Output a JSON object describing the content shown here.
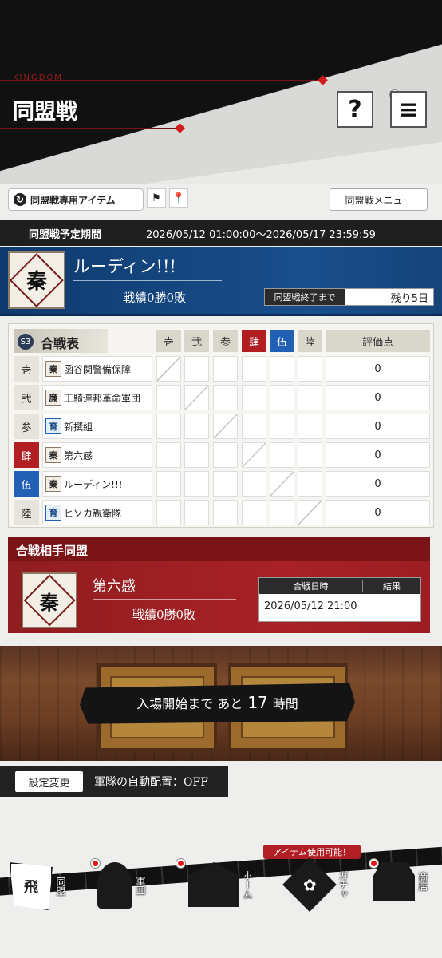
{
  "header": {
    "kingdom_label": "KINGDOM",
    "title": "同盟戦",
    "help_label": "?",
    "menu_label": "≡"
  },
  "toolbar": {
    "items_label": "同盟戦専用アイテム",
    "menu_label": "同盟戦メニュー"
  },
  "period": {
    "label": "同盟戦予定期間",
    "range": "2026/05/12 01:00:00～2026/05/17 23:59:59"
  },
  "my_alliance": {
    "emblem_char": "秦",
    "name": "ルーディン!!!",
    "record": "戦績0勝0敗",
    "end_label": "同盟戦終了まで",
    "remaining": "残り5日"
  },
  "battle_table": {
    "badge": "S3",
    "title": "合戦表",
    "columns": [
      "壱",
      "弐",
      "参",
      "肆",
      "伍",
      "陸"
    ],
    "points_header": "評価点",
    "rows": [
      {
        "label": "壱",
        "emblem": "秦",
        "name": "函谷関警備保障",
        "points": "0"
      },
      {
        "label": "弐",
        "emblem": "廉",
        "name": "王騎連邦革命軍団",
        "points": "0"
      },
      {
        "label": "参",
        "emblem": "育",
        "name": "新撰組",
        "points": "0"
      },
      {
        "label": "肆",
        "emblem": "秦",
        "name": "第六感",
        "points": "0"
      },
      {
        "label": "伍",
        "emblem": "秦",
        "name": "ルーディン!!!",
        "points": "0"
      },
      {
        "label": "陸",
        "emblem": "育",
        "name": "ヒソカ親衛隊",
        "points": "0"
      }
    ]
  },
  "opponent": {
    "header": "合戦相手同盟",
    "emblem_char": "秦",
    "name": "第六感",
    "record": "戦績0勝0敗",
    "date_header": "合戦日時",
    "result_header": "結果",
    "date": "2026/05/12 21:00",
    "result": ""
  },
  "entry": {
    "prefix": "入場開始まで あと",
    "count": "17",
    "unit": "時間"
  },
  "settings": {
    "button_label": "設定変更",
    "auto_deploy": "軍隊の自動配置：OFF"
  },
  "bottom_nav": {
    "item_usable": "アイテム使用可能！",
    "items": [
      {
        "label": "同盟",
        "icon": "flag-icon",
        "glyph": "飛"
      },
      {
        "label": "軍団",
        "icon": "helmet-icon"
      },
      {
        "label": "ホーム",
        "icon": "castle-icon"
      },
      {
        "label": "ガチャ",
        "icon": "gacha-icon",
        "glyph": "✿"
      },
      {
        "label": "商店",
        "icon": "shop-icon"
      }
    ]
  },
  "colors": {
    "blue_panel": "#1a4f8c",
    "red_panel": "#a82126",
    "accent_red": "#b11e24",
    "accent_blue": "#2260b6"
  }
}
